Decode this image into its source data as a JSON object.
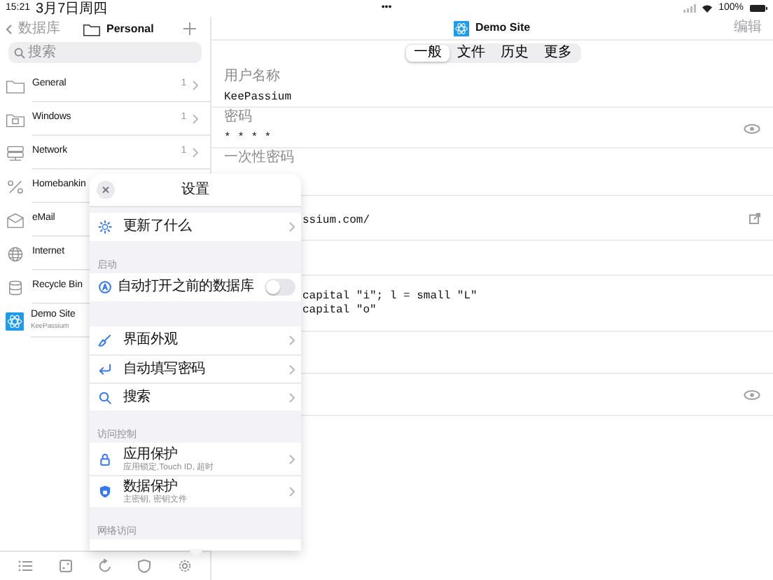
{
  "status_bar": {
    "time": "15:21",
    "date": "3月7日周四",
    "dots": "•••",
    "battery": "100%"
  },
  "sidebar": {
    "back": "数据库",
    "title": "Personal",
    "search": {
      "placeholder": "搜索"
    },
    "items": [
      {
        "name": "General",
        "count": "1"
      },
      {
        "name": "Windows",
        "count": "1"
      },
      {
        "name": "Network",
        "count": "1"
      },
      {
        "name": "Homebankin"
      },
      {
        "name": "eMail"
      },
      {
        "name": "Internet"
      },
      {
        "name": "Recycle Bin"
      },
      {
        "name": "Demo Site",
        "subtitle": "KeePassium"
      }
    ]
  },
  "detail": {
    "title": "Demo Site",
    "edit": "编辑",
    "segments": [
      {
        "label": "一般",
        "selected": true
      },
      {
        "label": "文件",
        "selected": false
      },
      {
        "label": "历史",
        "selected": false
      },
      {
        "label": "更多",
        "selected": false
      }
    ],
    "fields": [
      {
        "kind": "text",
        "label": "用户名称",
        "value": "KeePassium"
      },
      {
        "kind": "protected",
        "label": "密码",
        "value": "* * * *"
      },
      {
        "kind": "text",
        "label": "一次性密码"
      },
      {
        "kind": "url",
        "value": "ssium.com/"
      },
      {
        "kind": "blank"
      },
      {
        "kind": "notes",
        "lines": [
          "capital \"i\"; l = small \"L\"",
          "capital \"o\""
        ]
      },
      {
        "kind": "blank"
      },
      {
        "kind": "protected"
      }
    ]
  },
  "settings": {
    "title": "设置",
    "sections": [
      {
        "items": [
          {
            "kind": "link",
            "title": "更新了什么"
          }
        ]
      },
      {
        "header": "启动",
        "items": [
          {
            "kind": "toggle",
            "title": "自动打开之前的数据库",
            "on": false
          }
        ]
      },
      {
        "items": [
          {
            "kind": "link",
            "title": "界面外观"
          },
          {
            "kind": "link",
            "title": "自动填写密码"
          },
          {
            "kind": "link",
            "title": "搜索"
          }
        ]
      },
      {
        "header": "访问控制",
        "items": [
          {
            "kind": "link",
            "title": "应用保护",
            "subtitle": "应用锁定,Touch ID, 超时"
          },
          {
            "kind": "link",
            "title": "数据保护",
            "subtitle": "主密钥, 密钥文件"
          }
        ]
      },
      {
        "header": "网络访问",
        "items": [
          {
            "kind": "cut"
          }
        ]
      }
    ]
  }
}
